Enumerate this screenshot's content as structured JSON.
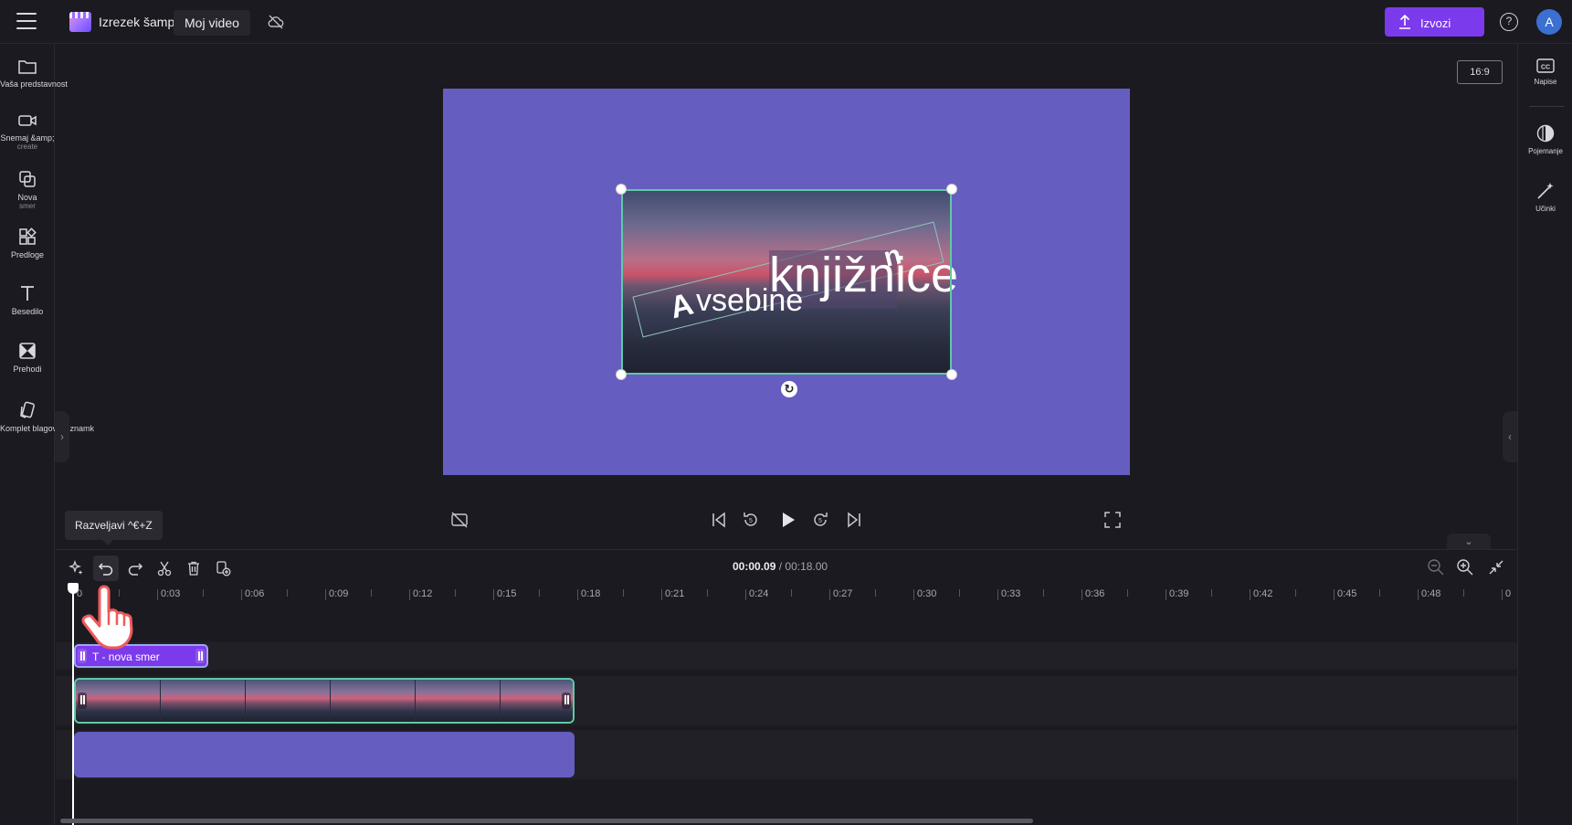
{
  "header": {
    "app_title": "Izrezek šampion",
    "project_name": "Moj video",
    "export_label": "Izvozi",
    "help_label": "?",
    "avatar_initial": "A"
  },
  "left_sidebar": {
    "items": [
      {
        "label": "Vaša predstavnost",
        "icon": "folder-icon"
      },
      {
        "label": "Snemaj &amp;",
        "sublabel": "create",
        "icon": "camera-icon"
      },
      {
        "label": "Nova",
        "sublabel": "smer",
        "icon": "new-direction-icon"
      },
      {
        "label": "Predloge",
        "icon": "templates-icon"
      },
      {
        "label": "Besedilo",
        "icon": "text-icon"
      },
      {
        "label": "Prehodi",
        "icon": "transitions-icon"
      },
      {
        "label": "Komplet blagovnih znamk",
        "icon": "brand-kit-icon"
      }
    ]
  },
  "right_sidebar": {
    "items": [
      {
        "label": "Napise",
        "icon": "captions-icon"
      },
      {
        "label": "Pojemanje",
        "icon": "fade-icon"
      },
      {
        "label": "Učinki",
        "icon": "effects-icon"
      }
    ]
  },
  "preview": {
    "aspect_ratio": "16:9",
    "canvas_color": "#665dc0",
    "overlay_text": {
      "main": "knjižnice",
      "secondary": "vsebine",
      "letter_a": "A",
      "letter_n": "n"
    }
  },
  "timeline": {
    "tooltip": "Razveljavi ^€+Z",
    "current_time": "00:00.09",
    "separator": " / ",
    "total_time": "00:18.00",
    "ruler_ticks": [
      "0",
      "0:03",
      "0:06",
      "0:09",
      "0:12",
      "0:15",
      "0:18",
      "0:21",
      "0:24",
      "0:27",
      "0:30",
      "0:33",
      "0:36",
      "0:39",
      "0:42",
      "0:45",
      "0:48",
      "0"
    ],
    "text_clip_label": "T - nova smer",
    "collapse_label": "⌄"
  },
  "colors": {
    "accent": "#7c3aed",
    "selection": "#5fc9a5",
    "background": "#1b1a20"
  }
}
